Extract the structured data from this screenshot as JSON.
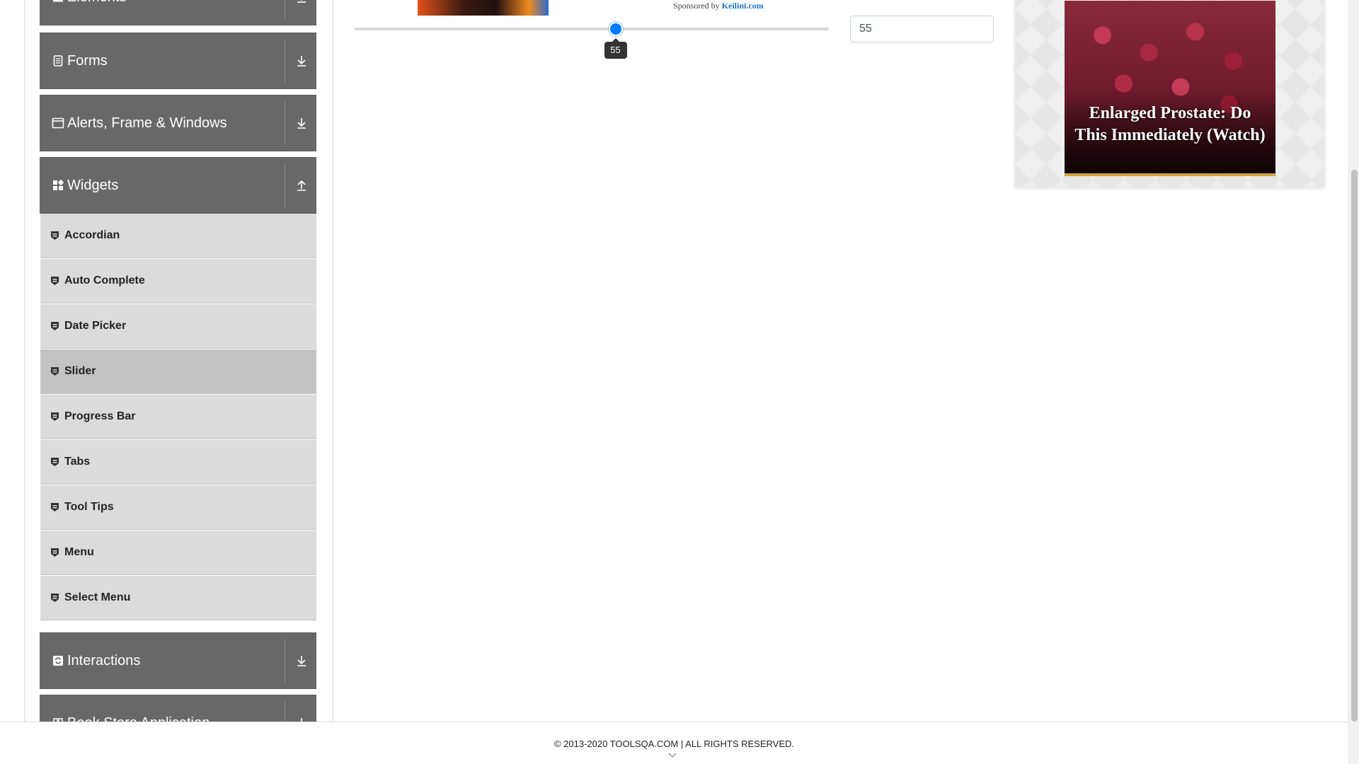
{
  "sidebar": {
    "groups": [
      {
        "label": "Elements",
        "icon": "list-icon",
        "toggle": "download-arrow-icon"
      },
      {
        "label": "Forms",
        "icon": "document-icon",
        "toggle": "download-arrow-icon"
      },
      {
        "label": "Alerts, Frame & Windows",
        "icon": "window-icon",
        "toggle": "download-arrow-icon"
      },
      {
        "label": "Widgets",
        "icon": "widgets-grid-icon",
        "toggle": "upload-arrow-icon"
      },
      {
        "label": "Interactions",
        "icon": "interaction-icon",
        "toggle": "download-arrow-icon"
      },
      {
        "label": "Book Store Application",
        "icon": "book-icon",
        "toggle": "download-arrow-icon"
      }
    ],
    "widgets_items": [
      {
        "label": "Accordian",
        "active": false
      },
      {
        "label": "Auto Complete",
        "active": false
      },
      {
        "label": "Date Picker",
        "active": false
      },
      {
        "label": "Slider",
        "active": true
      },
      {
        "label": "Progress Bar",
        "active": false
      },
      {
        "label": "Tabs",
        "active": false
      },
      {
        "label": "Tool Tips",
        "active": false
      },
      {
        "label": "Menu",
        "active": false
      },
      {
        "label": "Select Menu",
        "active": false
      }
    ]
  },
  "sponsor": {
    "prefix": "Sponsored by ",
    "link": "Keilini.com"
  },
  "slider": {
    "min": 0,
    "max": 100,
    "value": 55,
    "tooltip": "55",
    "accent_color": "#007bff"
  },
  "value_field": {
    "value": "55"
  },
  "right_ad": {
    "headline": "Enlarged Prostate: Do This Immediately (Watch)"
  },
  "footer": {
    "copyright": "© 2013-2020 TOOLSQA.COM | ALL RIGHTS RESERVED."
  }
}
